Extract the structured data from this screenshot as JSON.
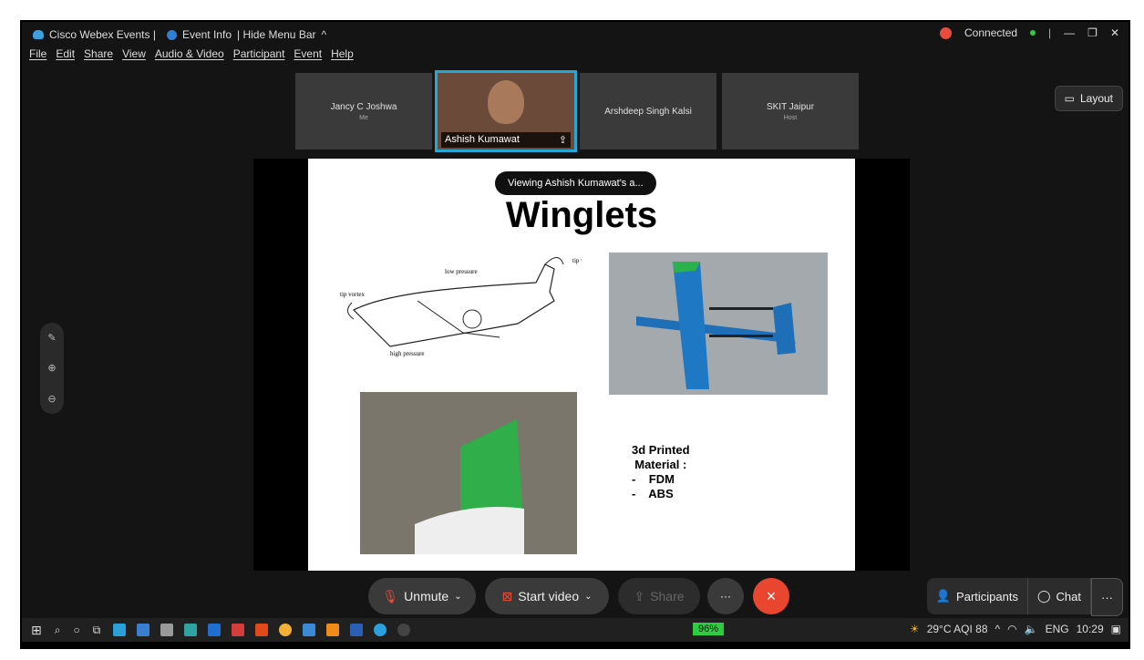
{
  "titlebar": {
    "app_name": "Cisco Webex Events |",
    "event_info": "Event Info",
    "hide_menu": "| Hide Menu Bar",
    "connected": "Connected",
    "status_color": "#2ecc40",
    "record_color": "#e74c3c"
  },
  "menu": [
    "File",
    "Edit",
    "Share",
    "View",
    "Audio & Video",
    "Participant",
    "Event",
    "Help"
  ],
  "participants": [
    {
      "name": "Jancy C Joshwa",
      "role": "Me"
    },
    {
      "name": "Ashish Kumawat",
      "role": ""
    },
    {
      "name": "Arshdeep Singh Kalsi",
      "role": ""
    },
    {
      "name": "SKIT Jaipur",
      "role": "Host"
    }
  ],
  "layout_label": "Layout",
  "share": {
    "banner": "Viewing Ashish Kumawat's a...",
    "title": "Winglets",
    "diagram_labels": {
      "tip_vortex": "tip vortex",
      "low_pressure": "low pressure",
      "high_pressure": "high pressure"
    },
    "text_lines": [
      "3d Printed",
      "Material :",
      "-    FDM",
      "-    ABS"
    ]
  },
  "controls": {
    "unmute": "Unmute",
    "start_video": "Start video",
    "share": "Share",
    "more": "···",
    "leave_icon": "×",
    "participants": "Participants",
    "chat": "Chat"
  },
  "taskbar": {
    "battery": "96%",
    "weather": "29°C AQI 88",
    "lang": "ENG",
    "time": "10:29"
  },
  "colors": {
    "accent": "#25a8d6",
    "leave": "#e8462f",
    "video_off": "#e05040"
  }
}
